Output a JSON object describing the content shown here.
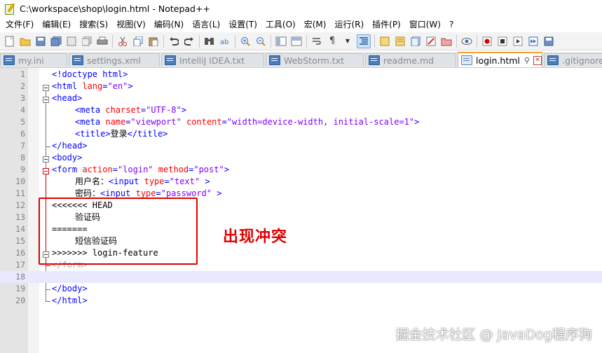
{
  "window": {
    "title": "C:\\workspace\\shop\\login.html - Notepad++"
  },
  "menu": [
    "文件(F)",
    "编辑(E)",
    "搜索(S)",
    "视图(V)",
    "编码(N)",
    "语言(L)",
    "设置(T)",
    "工具(O)",
    "宏(M)",
    "运行(R)",
    "插件(P)",
    "窗口(W)",
    "?"
  ],
  "tabs": [
    {
      "label": "my.ini",
      "active": false
    },
    {
      "label": "settings.xml",
      "active": false
    },
    {
      "label": "IntelliJ IDEA.txt",
      "active": false
    },
    {
      "label": "WebStorm.txt",
      "active": false
    },
    {
      "label": "readme.md",
      "active": false
    },
    {
      "label": "login.html",
      "active": true
    },
    {
      "label": ".gitignore",
      "active": false
    }
  ],
  "editor": {
    "current_line": 18,
    "lines": [
      {
        "n": "1",
        "text": "<!doctype html>"
      },
      {
        "n": "2",
        "text": "<html lang=\"en\">"
      },
      {
        "n": "3",
        "text": "<head>"
      },
      {
        "n": "4",
        "text": "<meta charset=\"UTF-8\">"
      },
      {
        "n": "5",
        "text": "<meta name=\"viewport\" content=\"width=device-width, initial-scale=1\">"
      },
      {
        "n": "6",
        "text": "<title>登录</title>"
      },
      {
        "n": "7",
        "text": "</head>"
      },
      {
        "n": "8",
        "text": "<body>"
      },
      {
        "n": "9",
        "text": "<form action=\"login\" method=\"post\">"
      },
      {
        "n": "10",
        "text": "用户名：<input type=\"text\" >"
      },
      {
        "n": "11",
        "text": "密码：<input type=\"password\" >"
      },
      {
        "n": "12",
        "text": "<<<<<<< HEAD"
      },
      {
        "n": "13",
        "text": "验证码"
      },
      {
        "n": "14",
        "text": "======="
      },
      {
        "n": "15",
        "text": "短信验证码"
      },
      {
        "n": "16",
        "text": ">>>>>>> login-feature"
      },
      {
        "n": "17",
        "text": "</form>"
      },
      {
        "n": "18",
        "text": ""
      },
      {
        "n": "19",
        "text": "</body>"
      },
      {
        "n": "20",
        "text": "</html>"
      }
    ]
  },
  "annotation": {
    "label": "出现冲突",
    "color": "#e00000"
  },
  "watermark": "掘金技术社区 @ JavaDog程序狗",
  "colors": {
    "tag": "#0000ff",
    "attribute": "#ff0000",
    "value": "#8000ff",
    "active_tab_accent": "#f0a22e",
    "current_line": "#e8e8ff"
  }
}
